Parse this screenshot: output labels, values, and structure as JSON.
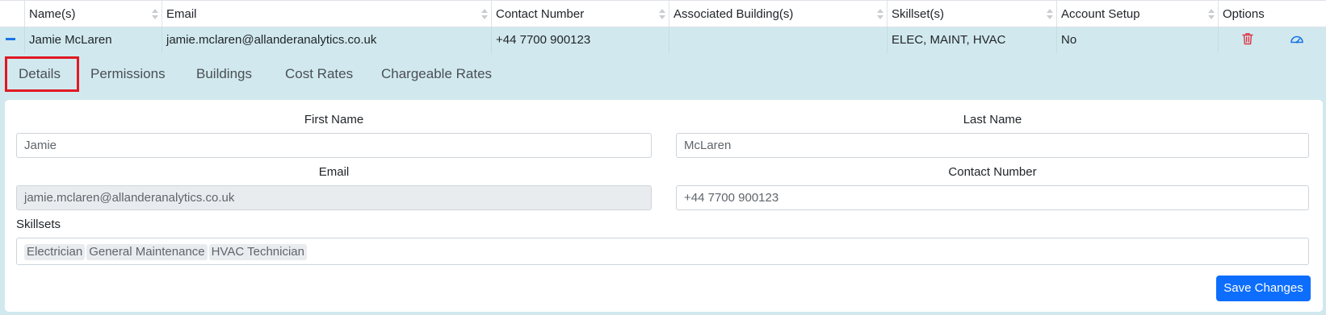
{
  "table": {
    "headers": [
      "Name(s)",
      "Email",
      "Contact Number",
      "Associated Building(s)",
      "Skillset(s)",
      "Account Setup",
      "Options"
    ],
    "row": {
      "name": "Jamie McLaren",
      "email": "jamie.mclaren@allanderanalytics.co.uk",
      "contact": "+44 7700 900123",
      "buildings": "",
      "skillsets": "ELEC, MAINT, HVAC",
      "account_setup": "No"
    }
  },
  "tabs": [
    "Details",
    "Permissions",
    "Buildings",
    "Cost Rates",
    "Chargeable Rates"
  ],
  "active_tab": "Details",
  "form": {
    "first_name_label": "First Name",
    "first_name_value": "Jamie",
    "last_name_label": "Last Name",
    "last_name_value": "McLaren",
    "email_label": "Email",
    "email_value": "jamie.mclaren@allanderanalytics.co.uk",
    "contact_label": "Contact Number",
    "contact_value": "+44 7700 900123",
    "skillsets_label": "Skillsets",
    "skills": [
      "Electrician",
      "General Maintenance",
      "HVAC Technician"
    ],
    "save_label": "Save Changes"
  },
  "colors": {
    "expanded_bg": "#d1e9ee",
    "primary": "#0d6efd",
    "danger": "#dc3545",
    "highlight": "#e01923"
  },
  "icons": {
    "collapse": "minus-icon",
    "delete": "trash-icon",
    "dashboard": "gauge-icon"
  }
}
